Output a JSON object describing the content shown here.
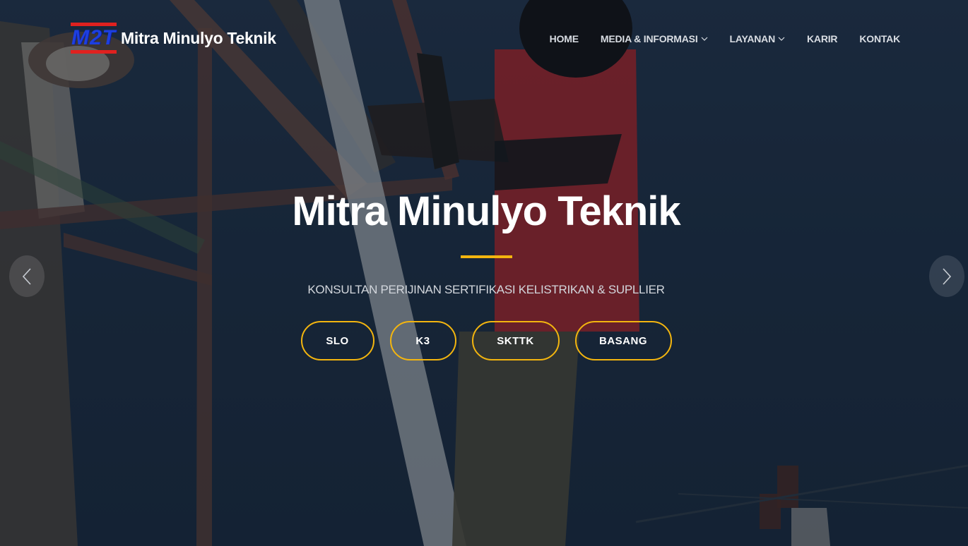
{
  "brand": {
    "logo_text": "M2T",
    "name": "Mitra Minulyo Teknik"
  },
  "nav": {
    "items": [
      {
        "label": "HOME",
        "has_dropdown": false
      },
      {
        "label": "MEDIA & INFORMASI",
        "has_dropdown": true
      },
      {
        "label": "LAYANAN",
        "has_dropdown": true
      },
      {
        "label": "KARIR",
        "has_dropdown": false
      },
      {
        "label": "KONTAK",
        "has_dropdown": false
      }
    ]
  },
  "hero": {
    "title": "Mitra Minulyo Teknik",
    "subtitle": "KONSULTAN PERIJINAN SERTIFIKASI KELISTRIKAN & SUPLLIER",
    "buttons": [
      "SLO",
      "K3",
      "SKTTK",
      "BASANG"
    ]
  },
  "carousel": {
    "prev_icon": "chevron-left-icon",
    "next_icon": "chevron-right-icon"
  },
  "colors": {
    "accent": "#f3b50f",
    "logo_red": "#e0211f",
    "logo_blue": "#1d3fe0",
    "hero_bg": "#1d2f45"
  }
}
